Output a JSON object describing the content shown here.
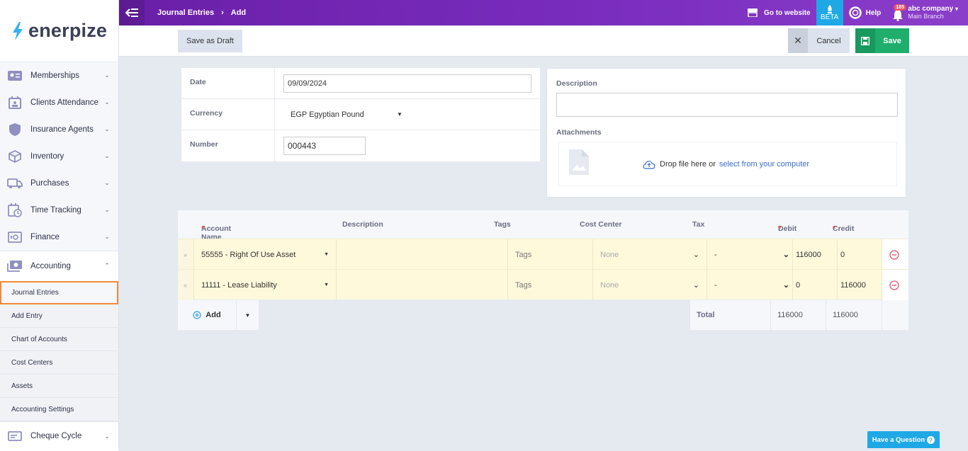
{
  "brand": {
    "name": "enerpize",
    "accent": "#1ea9e6"
  },
  "topbar": {
    "breadcrumb": [
      "Journal Entries",
      "Add"
    ],
    "go_to_website": "Go to website",
    "beta": "BETA",
    "help": "Help",
    "notifications_count": "185",
    "company": "abc company",
    "branch": "Main Branch"
  },
  "actions": {
    "save_draft": "Save as Draft",
    "cancel": "Cancel",
    "save": "Save"
  },
  "sidebar": {
    "items": [
      {
        "label": "Memberships",
        "icon": "id-card-icon"
      },
      {
        "label": "Clients Attendance",
        "icon": "calendar-user-icon"
      },
      {
        "label": "Insurance Agents",
        "icon": "shield-icon"
      },
      {
        "label": "Inventory",
        "icon": "box-icon"
      },
      {
        "label": "Purchases",
        "icon": "truck-icon"
      },
      {
        "label": "Time Tracking",
        "icon": "calendar-clock-icon"
      },
      {
        "label": "Finance",
        "icon": "safe-icon"
      }
    ],
    "accounting": {
      "label": "Accounting",
      "sub": [
        "Journal Entries",
        "Add Entry",
        "Chart of Accounts",
        "Cost Centers",
        "Assets",
        "Accounting Settings"
      ],
      "active": "Journal Entries"
    },
    "after": {
      "label": "Cheque Cycle",
      "icon": "cheque-icon"
    }
  },
  "form": {
    "date_label": "Date",
    "date_value": "09/09/2024",
    "currency_label": "Currency",
    "currency_value": "EGP Egyptian Pound",
    "number_label": "Number",
    "number_value": "000443",
    "description_label": "Description",
    "description_value": "",
    "attachments_label": "Attachments",
    "drop_text": "Drop file here or",
    "drop_link": "select from your computer"
  },
  "grid": {
    "headers": {
      "account": "Account Name",
      "description": "Description",
      "tags": "Tags",
      "cost_center": "Cost Center",
      "tax": "Tax",
      "debit": "Debit",
      "credit": "Credit",
      "required_mark": "*"
    },
    "rows": [
      {
        "account": "55555 - Right Of Use Asset",
        "description": "",
        "tags": "Tags",
        "cost_center": "None",
        "tax": "-",
        "debit": "116000",
        "credit": "0"
      },
      {
        "account": "11111 - Lease Liability",
        "description": "",
        "tags": "Tags",
        "cost_center": "None",
        "tax": "-",
        "debit": "0",
        "credit": "116000"
      }
    ],
    "add_label": "Add",
    "total_label": "Total",
    "total_debit": "116000",
    "total_credit": "116000"
  },
  "help_widget": {
    "label": "Have a Question"
  }
}
